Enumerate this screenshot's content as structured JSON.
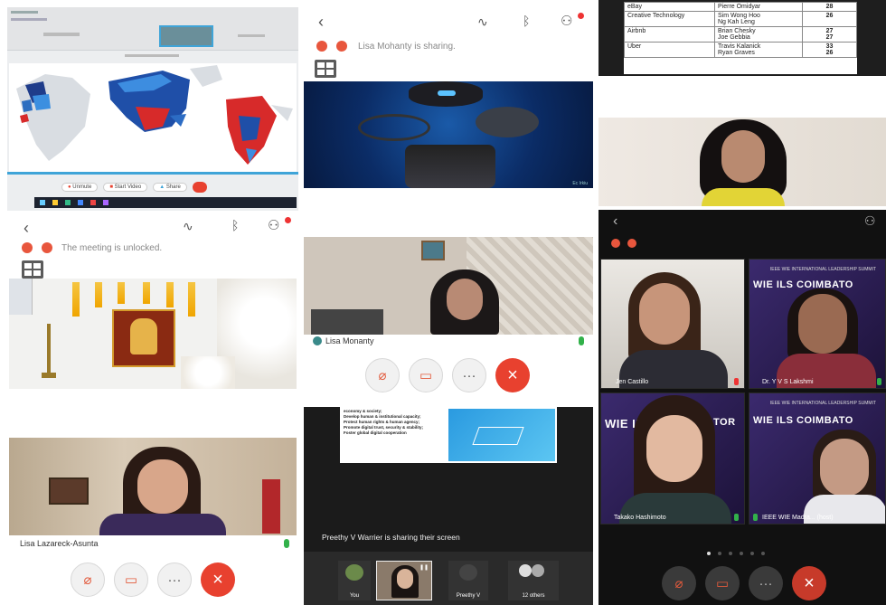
{
  "p1": {
    "toolbar_items": [
      "Unmute",
      "Start Video",
      "Share"
    ]
  },
  "p2": {
    "status": "The meeting is unlocked.",
    "participant": "Lisa Lazareck-Asunta"
  },
  "p3": {
    "status": "Lisa Mohanty is sharing.",
    "sharer_name": "Lisa Monanty",
    "slide_label": "Ec Irkiu",
    "share_status": "Preethy V Warrier is sharing their screen",
    "bullets": [
      "economy & society;",
      "Develop human & institutional capacity;",
      "Protect human rights & human agency;",
      "Promote digital trust, security & stability;",
      "Foster global digital cooperation"
    ],
    "thumbs": [
      {
        "label": "You"
      },
      {
        "label": ""
      },
      {
        "label": "Preethy V"
      },
      {
        "label": "12 others"
      }
    ]
  },
  "p4": {
    "table": [
      {
        "company": "eBay",
        "founders": [
          "Pierre Omidyar"
        ],
        "ages": [
          "28"
        ]
      },
      {
        "company": "Creative Technology",
        "founders": [
          "Sim Wong Hoo",
          "Ng Kah Leng"
        ],
        "ages": [
          "26"
        ]
      },
      {
        "company": "Airbnb",
        "founders": [
          "Brian Chesky",
          "Joe Gebbia"
        ],
        "ages": [
          "27",
          "27"
        ]
      },
      {
        "company": "Uber",
        "founders": [
          "Travis Kalanick",
          "Ryan Graves"
        ],
        "ages": [
          "33",
          "26"
        ]
      }
    ],
    "tiles": [
      {
        "name": "Jen Castillo"
      },
      {
        "name": "Dr. Y V S Lakshmi",
        "banner": "IEEE WIE INTERNATIONAL LEADERSHIP SUMMIT",
        "title": "WIE ILS COIMBATO"
      },
      {
        "name": "Takako Hashimoto",
        "title": "WIE ILS",
        "title2": "TOR"
      },
      {
        "name": "IEEE WIE Madra... (host)",
        "banner": "IEEE WIE INTERNATIONAL LEADERSHIP SUMMIT",
        "title": "WIE ILS COIMBATO"
      }
    ]
  }
}
